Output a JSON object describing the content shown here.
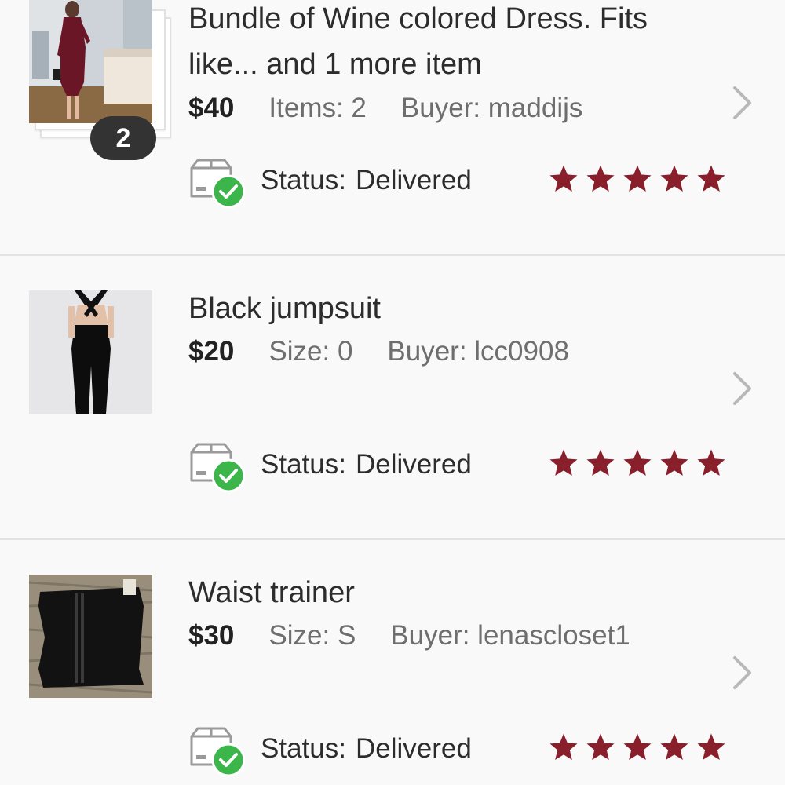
{
  "orders": [
    {
      "title": "Bundle of Wine colored Dress. Fits like... and 1 more item",
      "price": "$40",
      "detail": "Items: 2",
      "buyer": "Buyer: maddijs",
      "badge_count": "2",
      "status_label": "Status:",
      "status_value": "Delivered",
      "rating": 5,
      "thumbnail": "wine-dress-photo"
    },
    {
      "title": "Black jumpsuit",
      "price": "$20",
      "detail": "Size: 0",
      "buyer": "Buyer: lcc0908",
      "status_label": "Status:",
      "status_value": "Delivered",
      "rating": 5,
      "thumbnail": "black-jumpsuit-photo"
    },
    {
      "title": "Waist trainer",
      "price": "$30",
      "detail": "Size: S",
      "buyer": "Buyer: lenascloset1",
      "status_label": "Status:",
      "status_value": "Delivered",
      "rating": 5,
      "thumbnail": "waist-trainer-photo"
    }
  ],
  "icons": {
    "chevron": "chevron-right-icon",
    "status": "delivered-box-check-icon",
    "star": "star-icon"
  },
  "colors": {
    "star": "#8a1f2c",
    "check": "#3cb54a",
    "divider": "#e4e2e4",
    "background": "#faf9fa",
    "muted_text": "#6e6e6e"
  }
}
